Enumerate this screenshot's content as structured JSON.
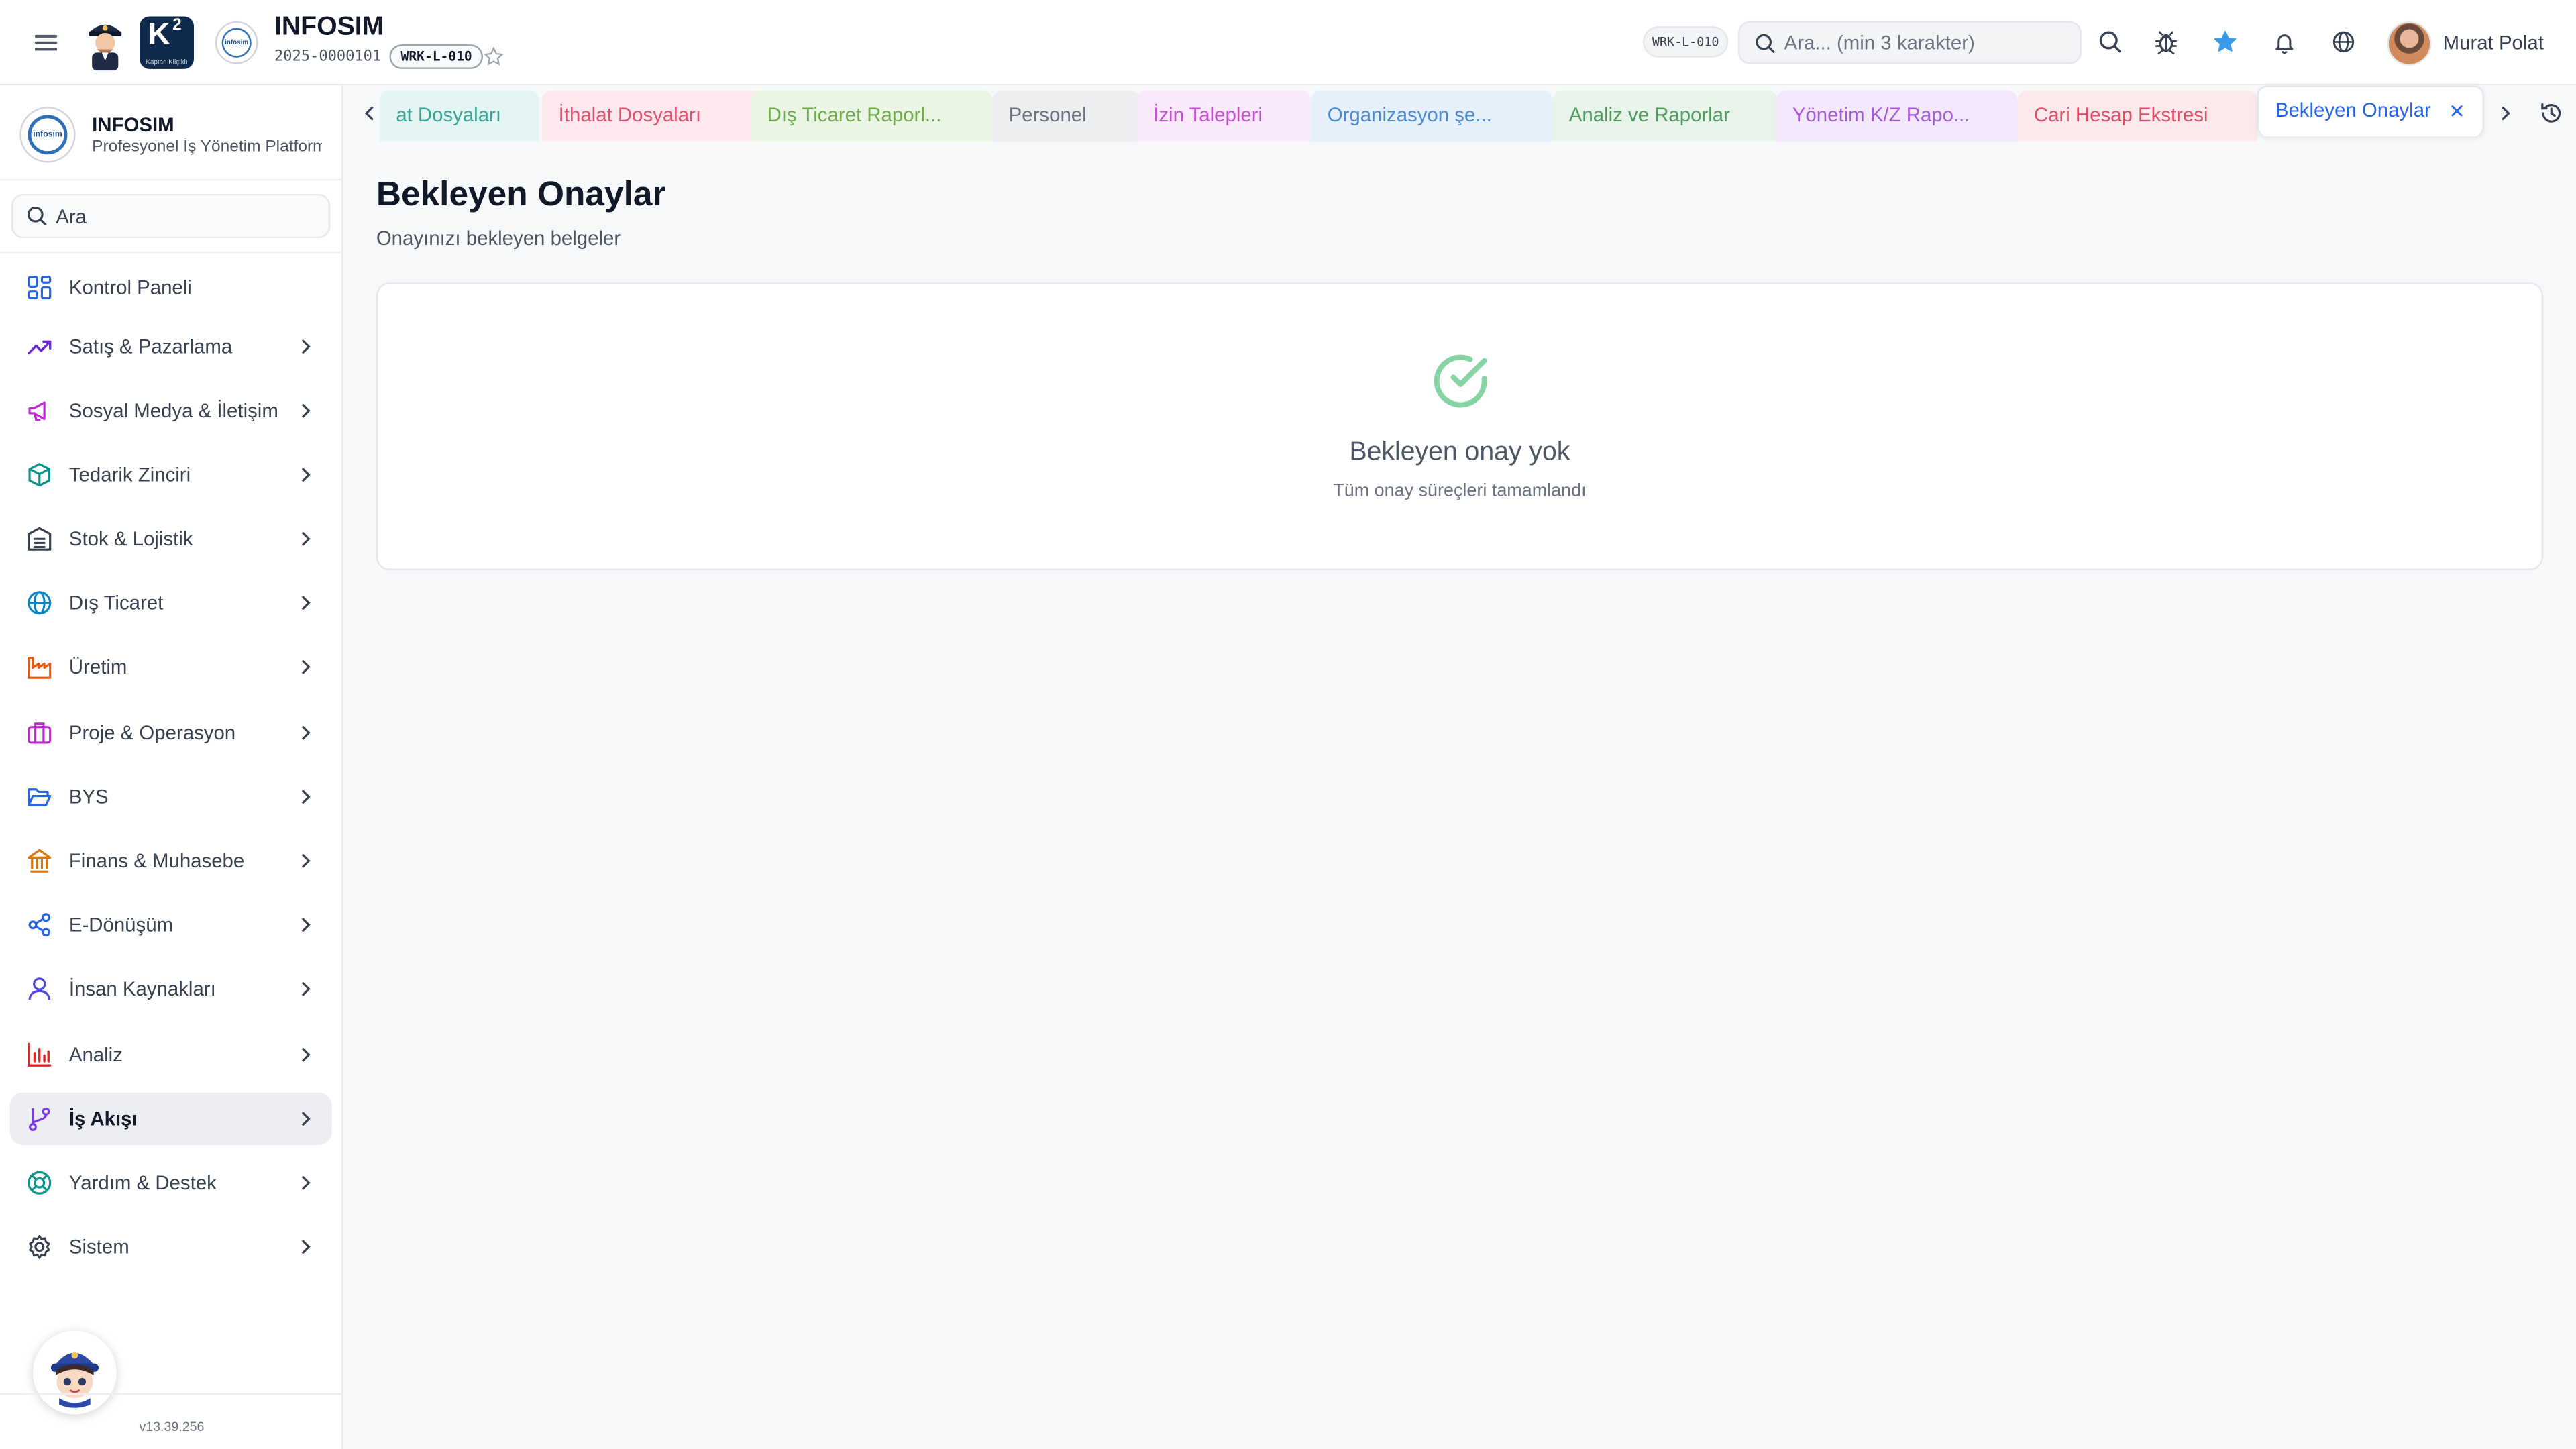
{
  "header": {
    "app_title": "INFOSIM",
    "document_no": "2025-0000101",
    "workstation_chip": "WRK-L-010",
    "workstation_chip_right": "WRK-L-010",
    "k2_logo_text": "K",
    "k2_logo_sup": "2",
    "k2_logo_caption": "Kaptan Kilçıklı",
    "brand_badge_text": "infosim",
    "search": {
      "placeholder": "Ara... (min 3 karakter)"
    },
    "icons": [
      "hamburger-icon",
      "star-icon",
      "search-icon",
      "bug-icon",
      "favorite-star-icon",
      "bell-icon",
      "globe-icon"
    ],
    "user": {
      "name": "Murat Polat"
    }
  },
  "sidebar": {
    "brand_name": "INFOSIM",
    "brand_subtitle": "Profesyonel İş Yönetim Platformu",
    "brand_logo_text": "infosim",
    "search_placeholder": "Ara",
    "items": [
      {
        "label": "Kontrol Paneli",
        "icon": "dashboard-icon",
        "color": "#2563eb",
        "has_children": false
      },
      {
        "label": "Satış & Pazarlama",
        "icon": "trending-up-icon",
        "color": "#6d28d9",
        "has_children": true
      },
      {
        "label": "Sosyal Medya & İletişim",
        "icon": "megaphone-icon",
        "color": "#c026d3",
        "has_children": true
      },
      {
        "label": "Tedarik Zinciri",
        "icon": "box-icon",
        "color": "#0d9488",
        "has_children": true
      },
      {
        "label": "Stok & Lojistik",
        "icon": "warehouse-icon",
        "color": "#374151",
        "has_children": true
      },
      {
        "label": "Dış Ticaret",
        "icon": "globe-icon",
        "color": "#0284c7",
        "has_children": true
      },
      {
        "label": "Üretim",
        "icon": "factory-icon",
        "color": "#ea580c",
        "has_children": true
      },
      {
        "label": "Proje & Operasyon",
        "icon": "briefcase-icon",
        "color": "#c026d3",
        "has_children": true
      },
      {
        "label": "BYS",
        "icon": "folder-open-icon",
        "color": "#2563eb",
        "has_children": true
      },
      {
        "label": "Finans & Muhasebe",
        "icon": "bank-icon",
        "color": "#d97706",
        "has_children": true
      },
      {
        "label": "E-Dönüşüm",
        "icon": "share-icon",
        "color": "#2563eb",
        "has_children": true
      },
      {
        "label": "İnsan Kaynakları",
        "icon": "user-icon",
        "color": "#4f46e5",
        "has_children": true
      },
      {
        "label": "Analiz",
        "icon": "bar-chart-icon",
        "color": "#dc2626",
        "has_children": true
      },
      {
        "label": "İş Akışı",
        "icon": "git-branch-icon",
        "color": "#7c3aed",
        "has_children": true,
        "active": true
      },
      {
        "label": "Yardım & Destek",
        "icon": "lifebuoy-icon",
        "color": "#0d9488",
        "has_children": true
      },
      {
        "label": "Sistem",
        "icon": "gear-icon",
        "color": "#374151",
        "has_children": true
      }
    ],
    "version": "v13.39.256"
  },
  "tabs": [
    {
      "label": "at Dosyaları",
      "bg": "#e3f5f2",
      "fg": "#3aa597"
    },
    {
      "label": "İthalat Dosyaları",
      "bg": "#fde8ee",
      "fg": "#e1506f"
    },
    {
      "label": "Dış Ticaret Raporl...",
      "bg": "#eaf5e3",
      "fg": "#6fab4e"
    },
    {
      "label": "Personel",
      "bg": "#edeef0",
      "fg": "#6b7280"
    },
    {
      "label": "İzin Talepleri",
      "bg": "#fae8fb",
      "fg": "#c34fd1"
    },
    {
      "label": "Organizasyon şe...",
      "bg": "#e5f0fb",
      "fg": "#4a8ad0"
    },
    {
      "label": "Analiz ve Raporlar",
      "bg": "#e8f4ea",
      "fg": "#4f9a5e"
    },
    {
      "label": "Yönetim K/Z Rapo...",
      "bg": "#f3e8fb",
      "fg": "#a45ad6"
    },
    {
      "label": "Cari Hesap Ekstresi",
      "bg": "#fbe9ec",
      "fg": "#df4f68"
    },
    {
      "label": "Bekleyen Onaylar",
      "bg": "#ffffff",
      "fg": "#2563eb",
      "active": true
    }
  ],
  "main": {
    "title": "Bekleyen Onaylar",
    "subtitle": "Onayınızı bekleyen belgeler",
    "empty_state": {
      "icon": "check-circle-icon",
      "title": "Bekleyen onay yok",
      "description": "Tüm onay süreçleri tamamlandı",
      "accent": "#86d4a3"
    }
  }
}
